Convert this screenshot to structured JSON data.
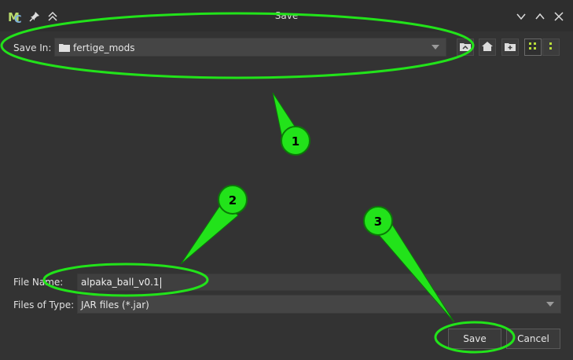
{
  "window": {
    "title": "Save"
  },
  "save_in": {
    "label": "Save In:",
    "folder": "fertige_mods"
  },
  "file_name": {
    "label": "File Name:",
    "value": "alpaka_ball_v0.1"
  },
  "files_of_type": {
    "label": "Files of Type:",
    "value": "JAR files (*.jar)"
  },
  "buttons": {
    "save": "Save",
    "cancel": "Cancel"
  },
  "annotations": [
    "1",
    "2",
    "3"
  ],
  "colors": {
    "highlight": "#22e31a",
    "background": "#333333",
    "titlebar": "#2e2e2e",
    "field": "#454545"
  },
  "icons": [
    "app-logo-icon",
    "pin-icon",
    "collapse-icon",
    "minimize-icon",
    "maximize-icon",
    "close-icon",
    "folder-icon",
    "up-folder-icon",
    "home-icon",
    "new-folder-icon",
    "list-view-icon",
    "details-view-icon"
  ]
}
